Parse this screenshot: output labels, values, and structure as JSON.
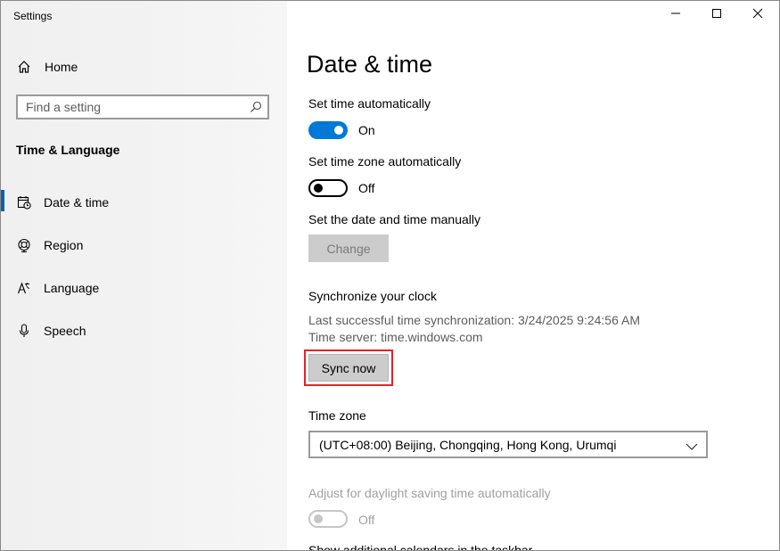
{
  "window": {
    "app_title": "Settings"
  },
  "sidebar": {
    "home_label": "Home",
    "search_placeholder": "Find a setting",
    "section_title": "Time & Language",
    "items": [
      {
        "label": "Date & time",
        "icon": "calendar-clock-icon",
        "active": true
      },
      {
        "label": "Region",
        "icon": "globe-icon",
        "active": false
      },
      {
        "label": "Language",
        "icon": "language-icon",
        "active": false
      },
      {
        "label": "Speech",
        "icon": "microphone-icon",
        "active": false
      }
    ]
  },
  "main": {
    "title": "Date & time",
    "set_time_auto": {
      "label": "Set time automatically",
      "state": "On"
    },
    "set_timezone_auto": {
      "label": "Set time zone automatically",
      "state": "Off"
    },
    "manual": {
      "label": "Set the date and time manually",
      "button": "Change"
    },
    "sync": {
      "heading": "Synchronize your clock",
      "last_sync": "Last successful time synchronization: 3/24/2025 9:24:56 AM",
      "server": "Time server: time.windows.com",
      "button": "Sync now"
    },
    "time_zone": {
      "label": "Time zone",
      "selected": "(UTC+08:00) Beijing, Chongqing, Hong Kong, Urumqi"
    },
    "daylight": {
      "label": "Adjust for daylight saving time automatically",
      "state": "Off"
    },
    "additional_calendars_label": "Show additional calendars in the taskbar"
  },
  "colors": {
    "accent": "#0078d7",
    "highlight_border": "#e0252a"
  }
}
